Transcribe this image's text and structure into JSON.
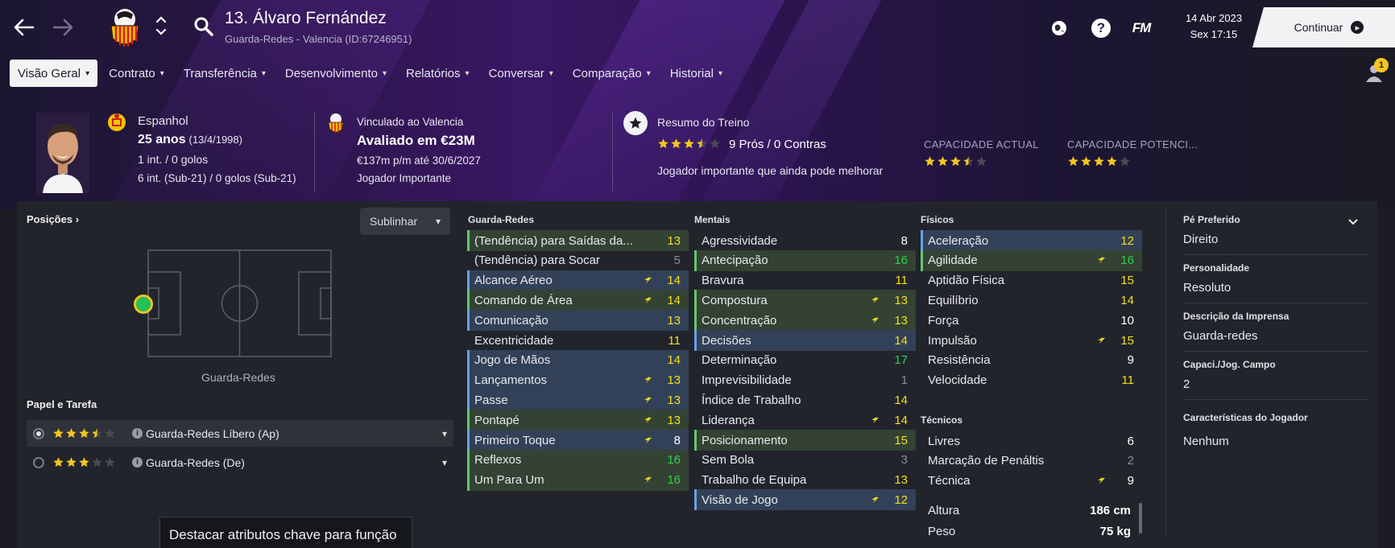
{
  "header": {
    "player_title": "13. Álvaro Fernández",
    "player_subtitle": "Guarda-Redes - Valencia (ID:67246951)",
    "date": "14 Abr 2023",
    "time": "Sex 17:15",
    "continue_label": "Continuar",
    "fm_logo": "FM",
    "help_icon_text": "?",
    "notification_count": "1"
  },
  "tabs": [
    {
      "label": "Visão Geral"
    },
    {
      "label": "Contrato"
    },
    {
      "label": "Transferência"
    },
    {
      "label": "Desenvolvimento"
    },
    {
      "label": "Relatórios"
    },
    {
      "label": "Conversar"
    },
    {
      "label": "Comparação"
    },
    {
      "label": "Historial"
    }
  ],
  "profile": {
    "nationality": "Espanhol",
    "age": "25 anos",
    "birth": "(13/4/1998)",
    "caps": "1 int. / 0 golos",
    "caps_u21": "6 int. (Sub-21) / 0 golos (Sub-21)",
    "contract_club": "Vinculado ao Valencia",
    "value": "Avaliado em €23M",
    "wage": "€137m p/m até 30/6/2027",
    "squad_status": "Jogador Importante",
    "training_title": "Resumo do Treino",
    "training_rating": 3.5,
    "training_pros_cons": "9 Prós / 0 Contras",
    "training_note": "Jogador importante que ainda pode melhorar",
    "current_ability_label": "CAPACIDADE ACTUAL",
    "current_ability": 3.5,
    "potential_ability_label": "CAPACIDADE POTENCI...",
    "potential_ability": 4
  },
  "positions": {
    "label": "Posições",
    "highlight_label": "Sublinhar",
    "pitch_label": "Guarda-Redes"
  },
  "roles": {
    "title": "Papel e Tarefa",
    "items": [
      {
        "name": "Guarda-Redes Líbero (Ap)",
        "rating": 3.5,
        "selected": true
      },
      {
        "name": "Guarda-Redes (De)",
        "rating": 3,
        "selected": false
      }
    ]
  },
  "tooltip": "Destacar atributos chave para função",
  "attributes": {
    "goalkeeping": {
      "title": "Guarda-Redes",
      "items": [
        {
          "name": "(Tendência) para Saídas da...",
          "value": "13",
          "style": "green",
          "bolt": false,
          "color": "yellow"
        },
        {
          "name": "(Tendência) para Socar",
          "value": "5",
          "style": "none",
          "bolt": false,
          "color": "grey"
        },
        {
          "name": "Alcance Aéreo",
          "value": "14",
          "style": "blue",
          "bolt": true,
          "color": "yellow"
        },
        {
          "name": "Comando de Área",
          "value": "14",
          "style": "green",
          "bolt": true,
          "color": "yellow"
        },
        {
          "name": "Comunicação",
          "value": "13",
          "style": "blue",
          "bolt": false,
          "color": "yellow"
        },
        {
          "name": "Excentricidade",
          "value": "11",
          "style": "none",
          "bolt": false,
          "color": "yellow"
        },
        {
          "name": "Jogo de Mãos",
          "value": "14",
          "style": "blue",
          "bolt": false,
          "color": "yellow"
        },
        {
          "name": "Lançamentos",
          "value": "13",
          "style": "blue",
          "bolt": true,
          "color": "yellow"
        },
        {
          "name": "Passe",
          "value": "13",
          "style": "blue",
          "bolt": true,
          "color": "yellow"
        },
        {
          "name": "Pontapé",
          "value": "13",
          "style": "green",
          "bolt": true,
          "color": "yellow"
        },
        {
          "name": "Primeiro Toque",
          "value": "8",
          "style": "blue",
          "bolt": true,
          "color": "white"
        },
        {
          "name": "Reflexos",
          "value": "16",
          "style": "green",
          "bolt": false,
          "color": "green"
        },
        {
          "name": "Um Para Um",
          "value": "16",
          "style": "green",
          "bolt": true,
          "color": "green"
        }
      ]
    },
    "mental": {
      "title": "Mentais",
      "items": [
        {
          "name": "Agressividade",
          "value": "8",
          "style": "none",
          "bolt": false,
          "color": "white"
        },
        {
          "name": "Antecipação",
          "value": "16",
          "style": "green",
          "bolt": false,
          "color": "green"
        },
        {
          "name": "Bravura",
          "value": "11",
          "style": "none",
          "bolt": false,
          "color": "yellow"
        },
        {
          "name": "Compostura",
          "value": "13",
          "style": "green",
          "bolt": true,
          "color": "yellow"
        },
        {
          "name": "Concentração",
          "value": "13",
          "style": "green",
          "bolt": true,
          "color": "yellow"
        },
        {
          "name": "Decisões",
          "value": "14",
          "style": "blue",
          "bolt": false,
          "color": "yellow"
        },
        {
          "name": "Determinação",
          "value": "17",
          "style": "none",
          "bolt": false,
          "color": "green"
        },
        {
          "name": "Imprevisibilidade",
          "value": "1",
          "style": "none",
          "bolt": false,
          "color": "grey"
        },
        {
          "name": "Índice de Trabalho",
          "value": "14",
          "style": "none",
          "bolt": false,
          "color": "yellow"
        },
        {
          "name": "Liderança",
          "value": "14",
          "style": "none",
          "bolt": true,
          "color": "yellow"
        },
        {
          "name": "Posicionamento",
          "value": "15",
          "style": "green",
          "bolt": false,
          "color": "yellow"
        },
        {
          "name": "Sem Bola",
          "value": "3",
          "style": "none",
          "bolt": false,
          "color": "grey"
        },
        {
          "name": "Trabalho de Equipa",
          "value": "13",
          "style": "none",
          "bolt": false,
          "color": "yellow"
        },
        {
          "name": "Visão de Jogo",
          "value": "12",
          "style": "blue",
          "bolt": true,
          "color": "yellow"
        }
      ]
    },
    "physical": {
      "title": "Físicos",
      "items": [
        {
          "name": "Aceleração",
          "value": "12",
          "style": "blue",
          "bolt": false,
          "color": "yellow"
        },
        {
          "name": "Agilidade",
          "value": "16",
          "style": "green",
          "bolt": true,
          "color": "green"
        },
        {
          "name": "Aptidão Física",
          "value": "15",
          "style": "none",
          "bolt": false,
          "color": "yellow"
        },
        {
          "name": "Equilíbrio",
          "value": "14",
          "style": "none",
          "bolt": false,
          "color": "yellow"
        },
        {
          "name": "Força",
          "value": "10",
          "style": "none",
          "bolt": false,
          "color": "white"
        },
        {
          "name": "Impulsão",
          "value": "15",
          "style": "none",
          "bolt": true,
          "color": "yellow"
        },
        {
          "name": "Resistência",
          "value": "9",
          "style": "none",
          "bolt": false,
          "color": "white"
        },
        {
          "name": "Velocidade",
          "value": "11",
          "style": "none",
          "bolt": false,
          "color": "yellow"
        }
      ]
    },
    "technical": {
      "title": "Técnicos",
      "items": [
        {
          "name": "Livres",
          "value": "6",
          "style": "none",
          "bolt": false,
          "color": "white"
        },
        {
          "name": "Marcação de Penáltis",
          "value": "2",
          "style": "none",
          "bolt": false,
          "color": "grey"
        },
        {
          "name": "Técnica",
          "value": "9",
          "style": "none",
          "bolt": true,
          "color": "white"
        }
      ]
    },
    "height_label": "Altura",
    "height": "186 cm",
    "weight_label": "Peso",
    "weight": "75 kg"
  },
  "details": [
    {
      "label": "Pé Preferido",
      "value": "Direito"
    },
    {
      "label": "Personalidade",
      "value": "Resoluto"
    },
    {
      "label": "Descrição da Imprensa",
      "value": "Guarda-redes"
    },
    {
      "label": "Capaci./Jog. Campo",
      "value": "2"
    },
    {
      "label": "Características do Jogador",
      "value": "Nenhum"
    }
  ],
  "colors": {
    "accent_purple": "#3a1764",
    "blue_highlight": "#324157",
    "green_highlight": "#334233",
    "value_yellow": "#f3df1c",
    "value_green": "#2fd24a",
    "star_gold": "#f3c620"
  }
}
